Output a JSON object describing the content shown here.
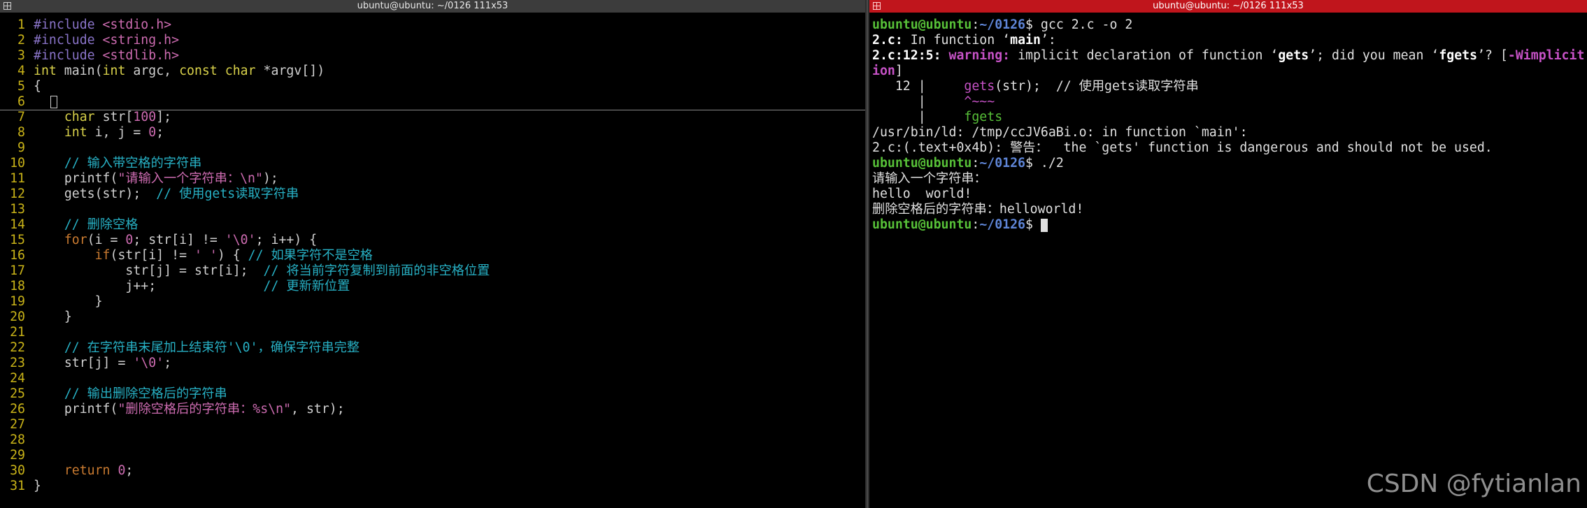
{
  "left_pane": {
    "title": "ubuntu@ubuntu: ~/0126 111x53",
    "line_numbers": [
      "1",
      "2",
      "3",
      "4",
      "5",
      "6",
      "7",
      "8",
      "9",
      "10",
      "11",
      "12",
      "13",
      "14",
      "15",
      "16",
      "17",
      "18",
      "19",
      "20",
      "21",
      "22",
      "23",
      "24",
      "25",
      "26",
      "27",
      "28",
      "29",
      "30",
      "31"
    ],
    "code": {
      "l1_directive": "#include",
      "l1_header": " <stdio.h>",
      "l2_directive": "#include",
      "l2_header": " <string.h>",
      "l3_directive": "#include",
      "l3_header": " <stdlib.h>",
      "l4_type": "int",
      "l4_fn": " main(",
      "l4_type2": "int",
      "l4_mid": " argc, ",
      "l4_const": "const",
      "l4_sp": " ",
      "l4_char": "char",
      "l4_end": " *argv[])",
      "l5_brace": "{",
      "l7_type": "char",
      "l7_rest": " str[",
      "l7_num": "100",
      "l7_end": "];",
      "l8_type": "int",
      "l8_rest": " i, j = ",
      "l8_num": "0",
      "l8_end": ";",
      "l10_comment": "// 输入带空格的字符串",
      "l11_fn": "printf(",
      "l11_str": "\"请输入一个字符串：\\n\"",
      "l11_end": ");",
      "l12_fn": "gets(str);  ",
      "l12_comment": "// 使用gets读取字符串",
      "l14_comment": "// 删除空格",
      "l15_for": "for",
      "l15_a": "(i = ",
      "l15_n0": "0",
      "l15_b": "; str[i] != ",
      "l15_chr": "'\\0'",
      "l15_c": "; i++) {",
      "l16_if": "if",
      "l16_a": "(str[i] != ",
      "l16_chr": "' '",
      "l16_b": ") { ",
      "l16_comment": "// 如果字符不是空格",
      "l17_code": "str[j] = str[i];  ",
      "l17_comment": "// 将当前字符复制到前面的非空格位置",
      "l18_code": "j++;              ",
      "l18_comment": "// 更新新位置",
      "l19_brace": "}",
      "l20_brace": "}",
      "l22_comment": "// 在字符串末尾加上结束符'\\0'，确保字符串完整",
      "l23_a": "str[j] = ",
      "l23_chr": "'\\0'",
      "l23_end": ";",
      "l25_comment": "// 输出删除空格后的字符串",
      "l26_fn": "printf(",
      "l26_str": "\"删除空格后的字符串：%s\\n\"",
      "l26_end": ", str);",
      "l30_ret": "return",
      "l30_sp": " ",
      "l30_num": "0",
      "l30_end": ";",
      "l31_brace": "}"
    }
  },
  "right_pane": {
    "title": "ubuntu@ubuntu: ~/0126 111x53",
    "prompt_user": "ubuntu@ubuntu",
    "prompt_colon": ":",
    "prompt_path": "~/0126",
    "prompt_dollar": "$ ",
    "cmd1": "gcc 2.c -o 2",
    "l2_file": "2.c:",
    "l2_rest": " In function ‘",
    "l2_main": "main",
    "l2_end": "’:",
    "l3_loc": "2.c:12:5: ",
    "l3_warn": "warning: ",
    "l3_a": "implicit declaration of function ‘",
    "l3_gets": "gets",
    "l3_b": "’; did you mean ‘",
    "l3_fgets": "fgets",
    "l3_c": "’? [",
    "l3_flag": "-Wimplicit",
    "l4_flag": "ion",
    "l4_end": "]",
    "l5_num": "   12 | ",
    "l5_gets": "    gets",
    "l5_rest": "(str);  // 使用gets读取字符串",
    "l6_bar": "      | ",
    "l6_caret": "    ^~~~",
    "l7_bar": "      | ",
    "l7_fix": "    fgets",
    "l8": "/usr/bin/ld: /tmp/ccJV6aBi.o: in function `main':",
    "l9": "2.c:(.text+0x4b): 警告：  the `gets' function is dangerous and should not be used.",
    "cmd2": "./2",
    "out1": "请输入一个字符串：",
    "out2": "hello  world!",
    "out3": "删除空格后的字符串：helloworld!"
  },
  "watermark": "CSDN @fytianlan"
}
